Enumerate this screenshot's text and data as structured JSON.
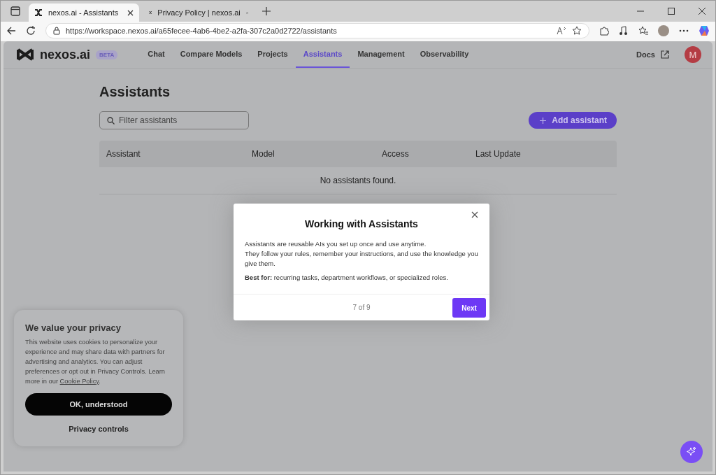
{
  "browser": {
    "tabs": [
      {
        "title": "nexos.ai - Assistants",
        "selected": true
      },
      {
        "title": "Privacy Policy | nexos.ai",
        "selected": false
      }
    ],
    "url": "https://workspace.nexos.ai/a65fecee-4ab6-4be2-a2fa-307c2a0d2722/assistants"
  },
  "app": {
    "logo": "nexos.ai",
    "badge": "BETA",
    "nav": [
      {
        "label": "Chat",
        "selected": false
      },
      {
        "label": "Compare Models",
        "selected": false
      },
      {
        "label": "Projects",
        "selected": false
      },
      {
        "label": "Assistants",
        "selected": true
      },
      {
        "label": "Management",
        "selected": false
      },
      {
        "label": "Observability",
        "selected": false
      }
    ],
    "docs": "Docs",
    "avatar": "M"
  },
  "page": {
    "title": "Assistants",
    "filter": {
      "placeholder": "Filter assistants"
    },
    "add_button": "Add assistant",
    "table": {
      "columns": [
        "Assistant",
        "Model",
        "Access",
        "Last Update"
      ],
      "empty": "No assistants found."
    }
  },
  "modal": {
    "title": "Working with Assistants",
    "lines": [
      "Assistants are reusable AIs you set up once and use anytime.",
      "They follow your rules, remember your instructions, and use the knowledge you give them."
    ],
    "best": "**Best for:** recurring tasks, department workflows, or specialized roles.",
    "step": "7 of 9",
    "next": "Next"
  },
  "cookie": {
    "title": "We value your privacy",
    "body": "This website uses cookies to personalize your experience and may share data with partners for advertising and analytics. You can adjust preferences or opt out in Privacy Controls. Learn more in our",
    "link": "Cookie Policy",
    "body_end": ".",
    "ok": "OK, understood",
    "controls": "Privacy controls"
  }
}
